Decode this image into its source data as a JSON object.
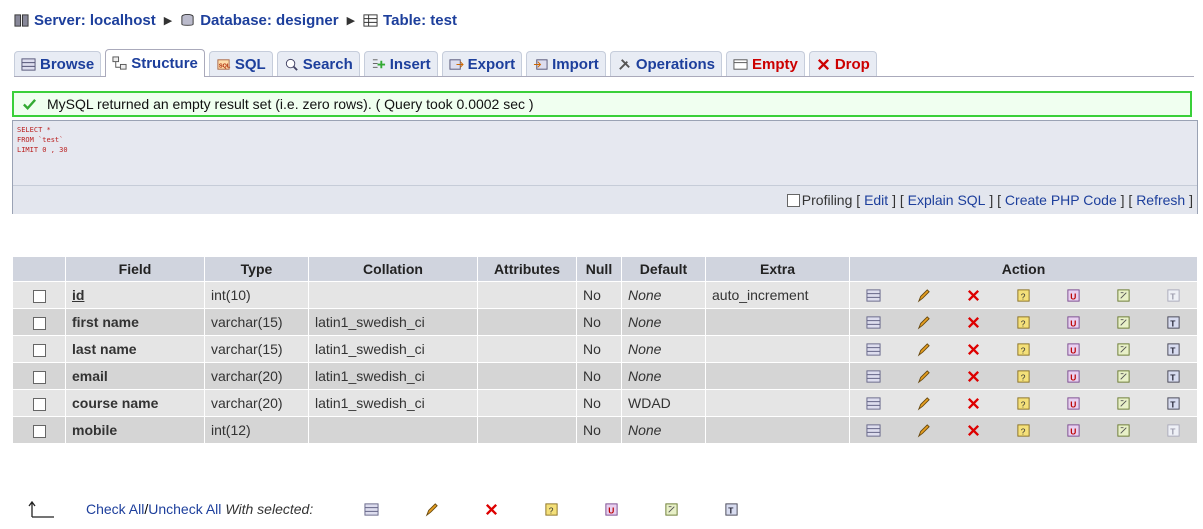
{
  "breadcrumb": {
    "server": "Server: localhost",
    "database": "Database: designer",
    "table": "Table: test"
  },
  "tabs": [
    {
      "label": "Browse"
    },
    {
      "label": "Structure"
    },
    {
      "label": "SQL"
    },
    {
      "label": "Search"
    },
    {
      "label": "Insert"
    },
    {
      "label": "Export"
    },
    {
      "label": "Import"
    },
    {
      "label": "Operations"
    },
    {
      "label": "Empty"
    },
    {
      "label": "Drop"
    }
  ],
  "message": "MySQL returned an empty result set (i.e. zero rows). ( Query took 0.0002 sec )",
  "sql": {
    "line1": "SELECT *",
    "line2": "FROM `test`",
    "line3": "LIMIT 0 , 30",
    "profiling_label": "Profiling",
    "edit": "Edit",
    "explain": "Explain SQL",
    "create_php": "Create PHP Code",
    "refresh": "Refresh"
  },
  "table": {
    "headers": {
      "field": "Field",
      "type": "Type",
      "collation": "Collation",
      "attributes": "Attributes",
      "null": "Null",
      "default": "Default",
      "extra": "Extra",
      "action": "Action"
    },
    "rows": [
      {
        "field": "id",
        "type": "int(10)",
        "collation": "",
        "attributes": "",
        "null": "No",
        "default": "None",
        "extra": "auto_increment"
      },
      {
        "field": "first name",
        "type": "varchar(15)",
        "collation": "latin1_swedish_ci",
        "attributes": "",
        "null": "No",
        "default": "None",
        "extra": ""
      },
      {
        "field": "last name",
        "type": "varchar(15)",
        "collation": "latin1_swedish_ci",
        "attributes": "",
        "null": "No",
        "default": "None",
        "extra": ""
      },
      {
        "field": "email",
        "type": "varchar(20)",
        "collation": "latin1_swedish_ci",
        "attributes": "",
        "null": "No",
        "default": "None",
        "extra": ""
      },
      {
        "field": "course name",
        "type": "varchar(20)",
        "collation": "latin1_swedish_ci",
        "attributes": "",
        "null": "No",
        "default": "WDAD",
        "extra": ""
      },
      {
        "field": "mobile",
        "type": "int(12)",
        "collation": "",
        "attributes": "",
        "null": "No",
        "default": "None",
        "extra": ""
      }
    ]
  },
  "bottom": {
    "check_all": "Check All",
    "slash": " / ",
    "uncheck_all": "Uncheck All",
    "with_selected": "With selected:"
  },
  "colors": {
    "link": "#1d3f9c",
    "danger": "#cc0000",
    "success_border": "#3ad03a"
  }
}
